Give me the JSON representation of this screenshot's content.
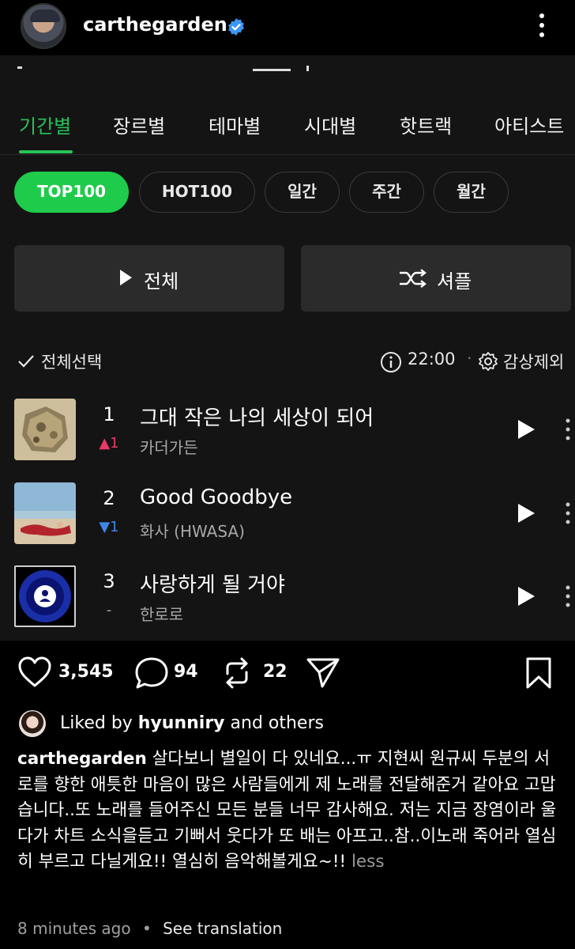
{
  "header": {
    "username": "carthegarden"
  },
  "tabs": [
    "기간별",
    "장르별",
    "테마별",
    "시대별",
    "핫트랙",
    "아티스트"
  ],
  "chips": [
    "TOP100",
    "HOT100",
    "일간",
    "주간",
    "월간"
  ],
  "buttons": {
    "play_all": "전체",
    "shuffle": "셔플"
  },
  "list_header": {
    "select_all": "전체선택",
    "time": "22:00",
    "exclude": "감상제외"
  },
  "tracks": [
    {
      "rank": "1",
      "change": "▲1",
      "change_color": "#e8386a",
      "title": "그대 작은 나의 세상이 되어",
      "artist": "카더가든"
    },
    {
      "rank": "2",
      "change": "▼1",
      "change_color": "#3f86e8",
      "title": "Good Goodbye",
      "artist": "화사 (HWASA)"
    },
    {
      "rank": "3",
      "change": "-",
      "change_color": "#a8a8a8",
      "title": "사랑하게 될 거야",
      "artist": "한로로"
    }
  ],
  "actions": {
    "likes": "3,545",
    "comments": "94",
    "reposts": "22"
  },
  "liked_by": {
    "prefix": "Liked by ",
    "user": "hyunniry",
    "suffix": " and others"
  },
  "caption": {
    "user": "carthegarden",
    "text": " 살다보니 별일이 다 있네요...ㅠ 지현씨 원규씨 두분의 서로를 향한 애틋한 마음이 많은 사람들에게 제 노래를 전달해준거 같아요 고맙습니다..또 노래를 들어주신 모든 분들 너무 감사해요. 저는 지금 장염이라 울다가 차트 소식을듣고 기뻐서 웃다가 또 배는 아프고..참..이노래 죽어라 열심히 부르고 다닐게요!! 열심히 음악해볼게요~!! ",
    "less": "less"
  },
  "meta": {
    "time": "8 minutes ago",
    "separator": "•",
    "translate": "See translation"
  },
  "colors": {
    "accent_green": "#1fcb4a",
    "tab_green": "#27c257",
    "verified_blue": "#3b96f5"
  }
}
